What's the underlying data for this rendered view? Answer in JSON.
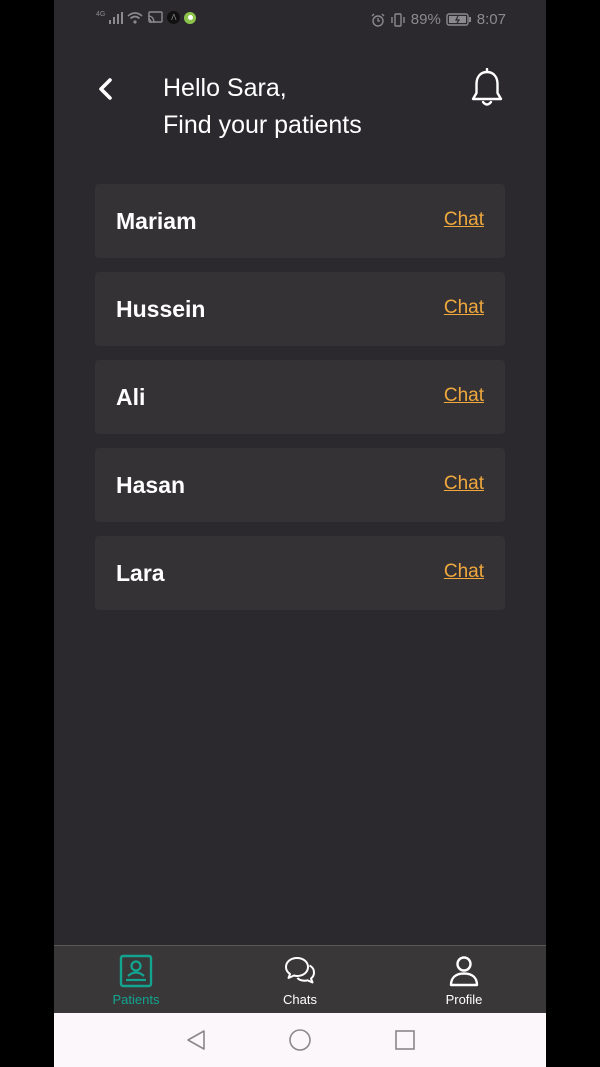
{
  "status_bar": {
    "network_label": "4G",
    "battery_percent": "89%",
    "time": "8:07"
  },
  "header": {
    "greeting_line1": "Hello Sara,",
    "greeting_line2": "Find your patients"
  },
  "patients": [
    {
      "name": "Mariam",
      "chat_label": "Chat"
    },
    {
      "name": "Hussein",
      "chat_label": "Chat"
    },
    {
      "name": "Ali",
      "chat_label": "Chat"
    },
    {
      "name": "Hasan",
      "chat_label": "Chat"
    },
    {
      "name": "Lara",
      "chat_label": "Chat"
    }
  ],
  "bottom_nav": {
    "items": [
      {
        "label": "Patients",
        "icon": "patients-icon",
        "active": true
      },
      {
        "label": "Chats",
        "icon": "chats-icon",
        "active": false
      },
      {
        "label": "Profile",
        "icon": "profile-icon",
        "active": false
      }
    ]
  },
  "colors": {
    "background": "#2b292d",
    "card": "#353236",
    "accent_link": "#f0a83c",
    "active_tab": "#13a48f"
  }
}
